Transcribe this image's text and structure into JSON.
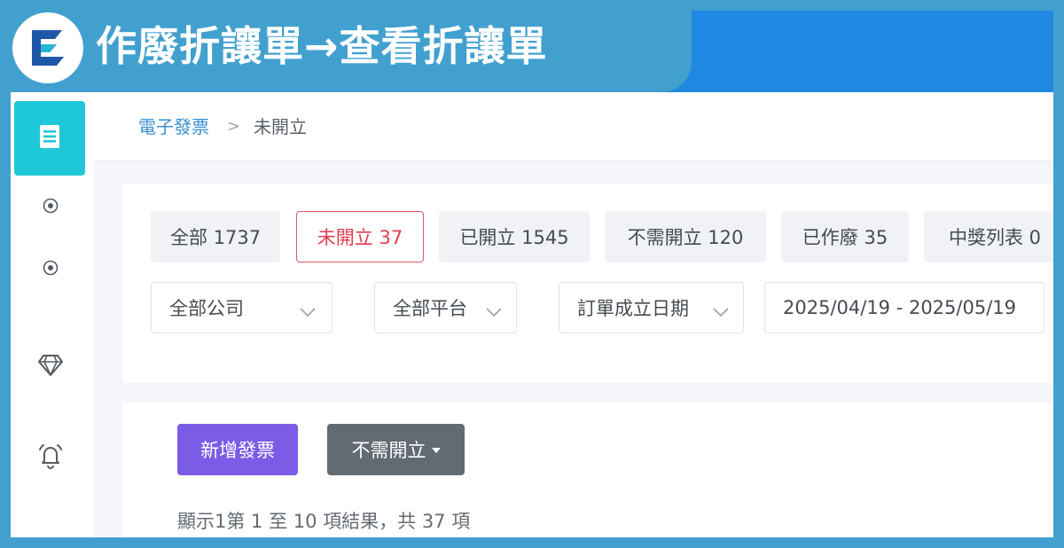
{
  "banner": {
    "title": "作廢折讓單→查看折讓單",
    "logo_icon": "e-logo-icon"
  },
  "colors": {
    "banner_bg": "#42a0cf",
    "header_blue": "#1e88e2",
    "sidebar_active": "#1fc8d8",
    "tab_active": "#e03e50",
    "primary_button": "#7b5ce6",
    "secondary_button": "#626b73",
    "breadcrumb_link": "#3a8fd1"
  },
  "sidebar": {
    "items": [
      {
        "icon": "invoice-list-icon",
        "active": true
      },
      {
        "icon": "radio-dot-icon"
      },
      {
        "icon": "radio-dot-icon"
      },
      {
        "icon": "diamond-icon"
      },
      {
        "icon": "bell-icon"
      }
    ]
  },
  "breadcrumb": {
    "parent": "電子發票",
    "separator": ">",
    "current": "未開立"
  },
  "tabs": [
    {
      "label": "全部 1737",
      "active": false
    },
    {
      "label": "未開立 37",
      "active": true
    },
    {
      "label": "已開立 1545",
      "active": false
    },
    {
      "label": "不需開立 120",
      "active": false
    },
    {
      "label": "已作廢 35",
      "active": false
    },
    {
      "label": "中獎列表 0",
      "active": false
    }
  ],
  "filters": {
    "company": "全部公司",
    "platform": "全部平台",
    "date_type": "訂單成立日期",
    "date_range": "2025/04/19 - 2025/05/19"
  },
  "actions": {
    "add_invoice": "新增發票",
    "no_invoice_dropdown": "不需開立"
  },
  "results": {
    "summary": "顯示1第 1 至 10 項結果，共 37 項"
  }
}
